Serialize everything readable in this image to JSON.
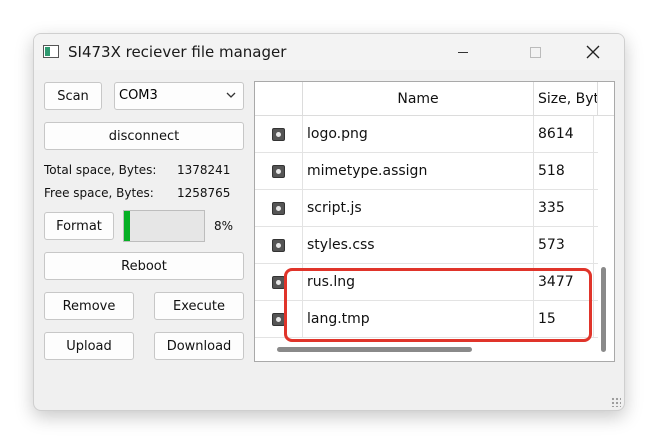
{
  "window": {
    "title": "SI473X reciever file manager",
    "icon": "app-window-icon",
    "controls": {
      "minimize": "minimize-icon",
      "maximize": "maximize-icon",
      "close": "✕"
    }
  },
  "left_panel": {
    "scan_label": "Scan",
    "port_value": "COM3",
    "disconnect_label": "disconnect",
    "total_space_label": "Total space, Bytes:",
    "total_space_value": "1378241",
    "free_space_label": "Free space, Bytes:",
    "free_space_value": "1258765",
    "format_label": "Format",
    "usage_percent_text": "8%",
    "usage_fraction": 0.08,
    "reboot_label": "Reboot",
    "remove_label": "Remove",
    "execute_label": "Execute",
    "upload_label": "Upload",
    "download_label": "Download"
  },
  "file_table": {
    "columns": [
      "",
      "Name",
      "Size, Byt"
    ],
    "rows": [
      {
        "icon": "image-file-icon",
        "name": "logo.png",
        "size": "8614"
      },
      {
        "icon": "file-icon",
        "name": "mimetype.assign",
        "size": "518"
      },
      {
        "icon": "file-icon",
        "name": "script.js",
        "size": "335"
      },
      {
        "icon": "file-icon",
        "name": "styles.css",
        "size": "573"
      },
      {
        "icon": "file-icon",
        "name": "rus.lng",
        "size": "3477"
      },
      {
        "icon": "file-icon",
        "name": "lang.tmp",
        "size": "15"
      }
    ]
  },
  "colors": {
    "highlight": "#e0342a",
    "progress": "#06b025"
  }
}
